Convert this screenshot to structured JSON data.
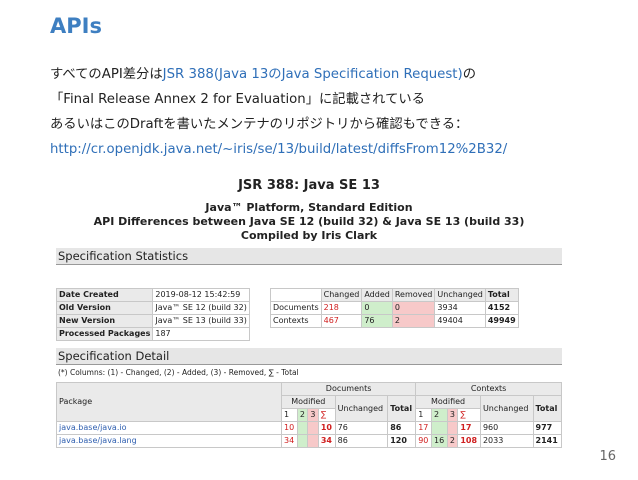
{
  "slide": {
    "title": "APIs",
    "line1_prefix": "すべてのAPI差分は",
    "line1_link": "JSR 388(Java 13のJava Specification Request)",
    "line1_suffix": "の",
    "line2": "「Final Release Annex 2 for Evaluation」に記載されている",
    "line3": "あるいはこのDraftを書いたメンテナのリポジトリから確認もできる：",
    "url": "http://cr.openjdk.java.net/~iris/se/13/build/latest/diffsFrom12%2B32/",
    "page_number": "16"
  },
  "report": {
    "title": "JSR 388: Java SE 13",
    "platform": "Java™ Platform, Standard Edition",
    "api_differences": "API Differences between Java SE 12 (build 32) & Java SE 13 (build 33)",
    "compiled_by": "Compiled by Iris Clark",
    "stats_heading": "Specification Statistics",
    "info_rows": [
      {
        "label": "Date Created",
        "value": "2019-08-12 15:42:59"
      },
      {
        "label": "Old Version",
        "value": "Java™ SE 12 (build 32)"
      },
      {
        "label": "New Version",
        "value": "Java™ SE 13 (build 33)"
      },
      {
        "label": "Processed Packages",
        "value": "187"
      }
    ],
    "stats_header": [
      "Changed",
      "Added",
      "Removed",
      "Unchanged",
      "Total"
    ],
    "stats_rows": [
      {
        "label": "Documents",
        "changed": "218",
        "added": "0",
        "removed": "0",
        "unchanged": "3934",
        "total": "4152"
      },
      {
        "label": "Contexts",
        "changed": "467",
        "added": "76",
        "removed": "2",
        "unchanged": "49404",
        "total": "49949"
      }
    ],
    "detail_heading": "Specification Detail",
    "legend": "(*) Columns: (1) - Changed, (2) - Added, (3) - Removed, ∑ - Total",
    "detail_header": {
      "package": "Package",
      "documents": "Documents",
      "contexts": "Contexts",
      "modified": "Modified",
      "unchanged": "Unchanged",
      "total": "Total",
      "c1": "1",
      "c2": "2",
      "c3": "3",
      "sum": "∑"
    },
    "detail_rows": [
      {
        "package": "java.base/java.io",
        "d1": "10",
        "d2": "",
        "d3": "",
        "dsum": "10",
        "dun": "76",
        "dtot": "86",
        "c1": "17",
        "c2": "",
        "c3": "",
        "csum": "17",
        "cun": "960",
        "ctot": "977"
      },
      {
        "package": "java.base/java.lang",
        "d1": "34",
        "d2": "",
        "d3": "",
        "dsum": "34",
        "dun": "86",
        "dtot": "120",
        "c1": "90",
        "c2": "16",
        "c3": "2",
        "csum": "108",
        "cun": "2033",
        "ctot": "2141"
      }
    ]
  }
}
